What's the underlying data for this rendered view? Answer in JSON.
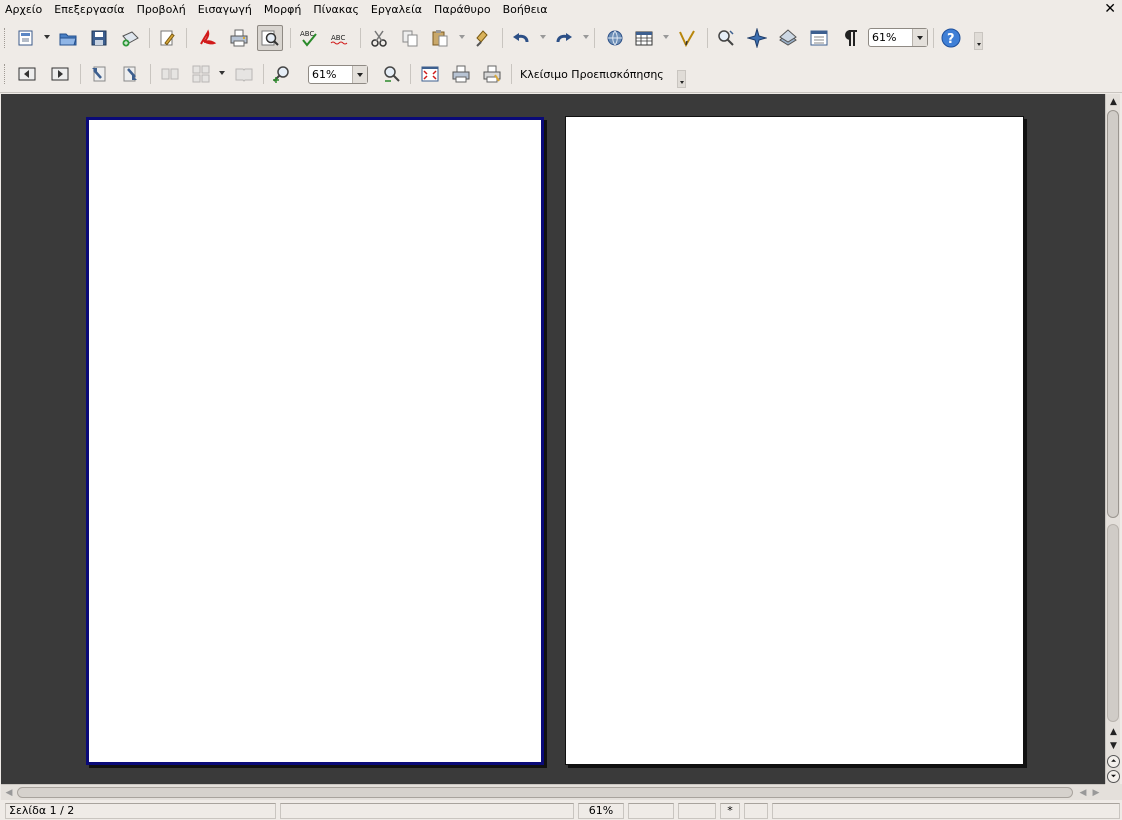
{
  "menubar": {
    "items": [
      "Αρχείο",
      "Επεξεργασία",
      "Προβολή",
      "Εισαγωγή",
      "Μορφή",
      "Πίνακας",
      "Εργαλεία",
      "Παράθυρο",
      "Βοήθεια"
    ],
    "close_glyph": "✕"
  },
  "toolbar_standard": {
    "zoom_value": "61%",
    "icons": [
      "new-document-icon",
      "open-folder-icon",
      "save-icon",
      "send-email-icon",
      "edit-file-icon",
      "export-pdf-icon",
      "print-icon",
      "page-preview-icon",
      "spellcheck-icon",
      "auto-spellcheck-icon",
      "cut-icon",
      "copy-icon",
      "paste-icon",
      "clone-format-icon",
      "undo-icon",
      "redo-icon",
      "hyperlink-icon",
      "table-icon",
      "draw-functions-icon",
      "navigator-icon",
      "gallery-icon",
      "data-sources-icon",
      "formatting-marks-icon",
      "help-icon"
    ]
  },
  "toolbar_preview": {
    "zoom_value": "61%",
    "close_preview_label": "Κλείσιμο Προεπισκόπησης"
  },
  "status": {
    "page_info": "Σελίδα 1 / 2",
    "zoom": "61%",
    "modified": "*"
  },
  "colors": {
    "workspace": "#3a3a3a",
    "selected_page_border": "#0a0a78",
    "chrome": "#efebe7"
  }
}
